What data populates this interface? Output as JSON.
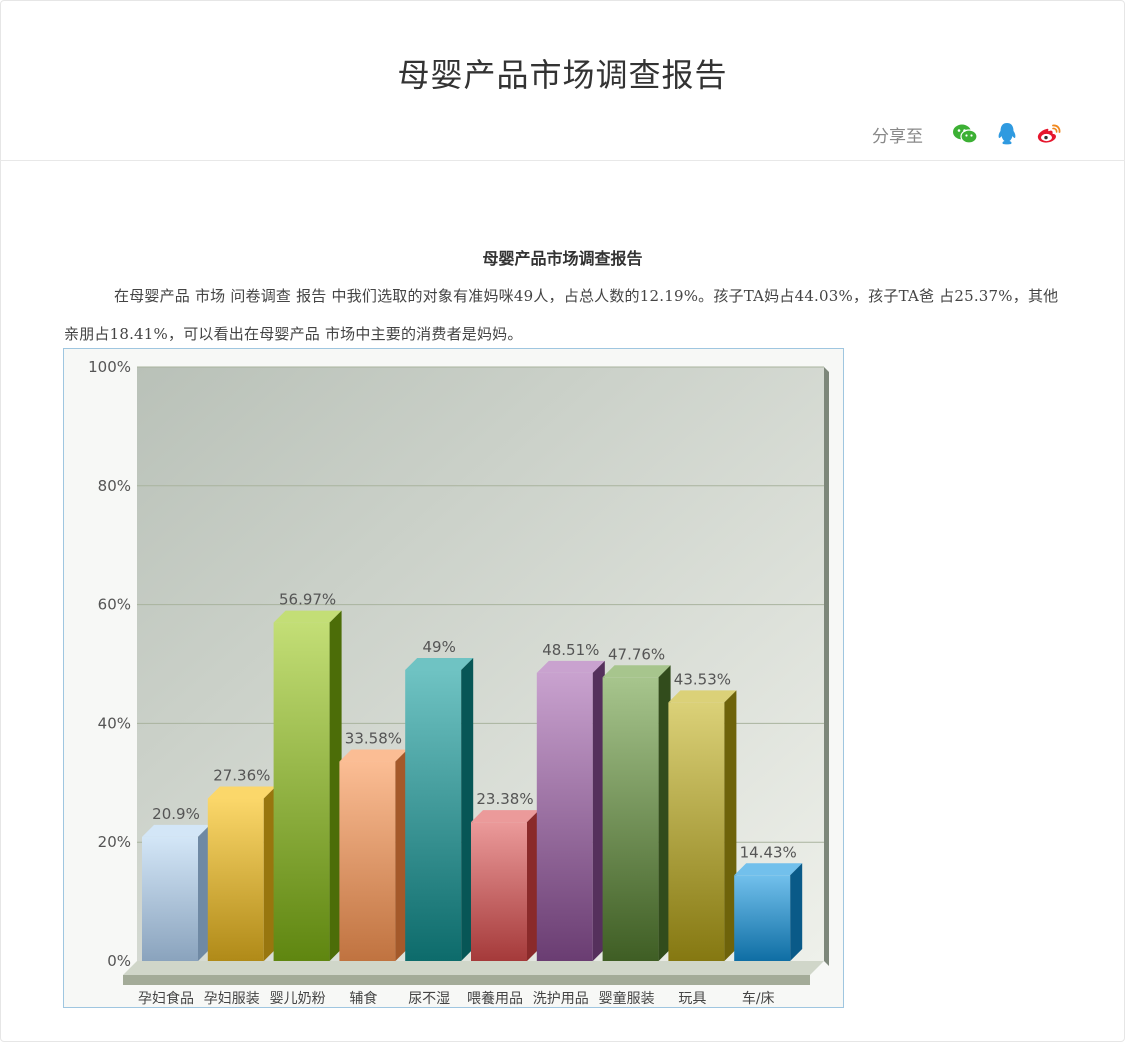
{
  "header": {
    "title": "母婴产品市场调查报告",
    "share_label": "分享至",
    "share_icons": [
      "wechat-icon",
      "qq-icon",
      "weibo-icon"
    ]
  },
  "article": {
    "title": "母婴产品市场调查报告",
    "body": "在母婴产品 市场 问卷调查 报告 中我们选取的对象有准妈咪49人，占总人数的12.19%。孩子TA妈占44.03%，孩子TA爸 占25.37%，其他亲朋占18.41%，可以看出在母婴产品 市场中主要的消费者是妈妈。"
  },
  "chart_data": {
    "type": "bar",
    "categories": [
      "孕妇食品",
      "孕妇服装",
      "婴儿奶粉",
      "辅食",
      "尿不湿",
      "喂養用品",
      "洗护用品",
      "婴童服装",
      "玩具",
      "车/床"
    ],
    "values": [
      20.9,
      27.36,
      56.97,
      33.58,
      49,
      23.38,
      48.51,
      47.76,
      43.53,
      14.43
    ],
    "value_labels": [
      "20.9%",
      "27.36%",
      "56.97%",
      "33.58%",
      "49%",
      "23.38%",
      "48.51%",
      "47.76%",
      "43.53%",
      "14.43%"
    ],
    "ylim": [
      0,
      100
    ],
    "yticks": [
      "0%",
      "20%",
      "40%",
      "60%",
      "80%",
      "100%"
    ],
    "grid": true,
    "colors": [
      [
        "#d3e6f7",
        "#8aa3bd",
        "#6f89a4"
      ],
      [
        "#fbd76a",
        "#b08a18",
        "#98760e"
      ],
      [
        "#c3de76",
        "#5f8610",
        "#4c6d08"
      ],
      [
        "#fbbd94",
        "#c07340",
        "#a4592a"
      ],
      [
        "#6fc3c3",
        "#0d6b6b",
        "#075656"
      ],
      [
        "#eb9a9a",
        "#a53a3a",
        "#8a2a2a"
      ],
      [
        "#c9a2cf",
        "#6a3d72",
        "#55305c"
      ],
      [
        "#a7c58d",
        "#3f5e24",
        "#324c1c"
      ],
      [
        "#dbd178",
        "#857811",
        "#6e630a"
      ],
      [
        "#72c0ec",
        "#0f6ea4",
        "#0a5a88"
      ]
    ]
  }
}
